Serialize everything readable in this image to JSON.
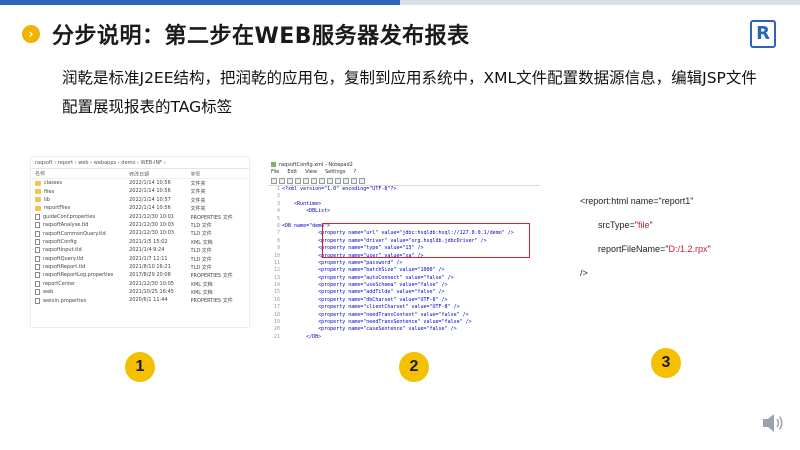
{
  "slide": {
    "title": "分步说明：第二步在WEB服务器发布报表",
    "bullet_glyph": "›",
    "logo_letter": "R",
    "description": "润乾是标准J2EE结构，把润乾的应用包，复制到应用系统中，XML文件配置数据源信息，编辑JSP文件配置展现报表的TAG标签"
  },
  "explorer": {
    "path": "raqsoft  ›  report  ›  web  ›  webapps  ›  demo  ›  WEB-INF  ›",
    "headers": [
      "名称",
      "修改日期",
      "类型"
    ],
    "rows": [
      {
        "name": "classes",
        "date": "2022/1/14 10:56",
        "type": "文件夹",
        "icon": "folder"
      },
      {
        "name": "files",
        "date": "2022/1/14 10:56",
        "type": "文件夹",
        "icon": "folder"
      },
      {
        "name": "lib",
        "date": "2022/1/14 10:57",
        "type": "文件夹",
        "icon": "folder"
      },
      {
        "name": "reportFiles",
        "date": "2022/1/14 10:56",
        "type": "文件夹",
        "icon": "folder"
      },
      {
        "name": "guideConf.properties",
        "date": "2021/12/30 10:01",
        "type": "PROPERTIES 文件",
        "icon": "file"
      },
      {
        "name": "raqsoftAnalyse.tld",
        "date": "2021/12/30 10:03",
        "type": "TLD 文件",
        "icon": "file"
      },
      {
        "name": "raqsoftCommonQuery.tld",
        "date": "2021/12/30 10:03",
        "type": "TLD 文件",
        "icon": "file"
      },
      {
        "name": "raqsoftConfig",
        "date": "2021/1/5 15:02",
        "type": "XML 文档",
        "icon": "file"
      },
      {
        "name": "raqsoftInput.tld",
        "date": "2021/1/4 9:24",
        "type": "TLD 文件",
        "icon": "file"
      },
      {
        "name": "raqsoftQuery.tld",
        "date": "2021/1/7 11:11",
        "type": "TLD 文件",
        "icon": "file"
      },
      {
        "name": "raqsoftReport.tld",
        "date": "2021/8/10 16:21",
        "type": "TLD 文件",
        "icon": "file"
      },
      {
        "name": "raqsoftReportLog.properties",
        "date": "2017/8/29 20:08",
        "type": "PROPERTIES 文件",
        "icon": "file"
      },
      {
        "name": "reportCenter",
        "date": "2021/12/30 10:05",
        "type": "XML 文档",
        "icon": "file"
      },
      {
        "name": "web",
        "date": "2021/10/25 16:45",
        "type": "XML 文档",
        "icon": "file"
      },
      {
        "name": "weixin.properties",
        "date": "2020/6/1 11:44",
        "type": "PROPERTIES 文件",
        "icon": "file"
      }
    ]
  },
  "notepad": {
    "title": "raqsoftConfig.xml - Notepad2",
    "menu": [
      "File",
      "Edit",
      "View",
      "Settings",
      "?"
    ],
    "lines": [
      {
        "n": "1",
        "text": "<?xml version=\"1.0\" encoding=\"UTF-8\"?>"
      },
      {
        "n": "2",
        "text": ""
      },
      {
        "n": "3",
        "text": "    <Runtime>"
      },
      {
        "n": "4",
        "text": "        <DBList>"
      },
      {
        "n": "5",
        "text": ""
      },
      {
        "n": "6",
        "text": "<DB name=\"demo\">"
      },
      {
        "n": "7",
        "text": "            <property name=\"url\" value=\"jdbc:hsqldb:hsql://127.0.0.1/demo\" />"
      },
      {
        "n": "8",
        "text": "            <property name=\"driver\" value=\"org.hsqldb.jdbcDriver\" />"
      },
      {
        "n": "9",
        "text": "            <property name=\"type\" value=\"13\" />"
      },
      {
        "n": "10",
        "text": "            <property name=\"user\" value=\"sa\" />"
      },
      {
        "n": "11",
        "text": "            <property name=\"password\" />"
      },
      {
        "n": "12",
        "text": "            <property name=\"batchSize\" value=\"1000\" />"
      },
      {
        "n": "13",
        "text": "            <property name=\"autoConnect\" value=\"false\" />"
      },
      {
        "n": "14",
        "text": "            <property name=\"useSchema\" value=\"false\" />"
      },
      {
        "n": "15",
        "text": "            <property name=\"addTilde\" value=\"false\" />"
      },
      {
        "n": "16",
        "text": "            <property name=\"dbCharset\" value=\"UTF-8\" />"
      },
      {
        "n": "17",
        "text": "            <property name=\"clientCharset\" value=\"UTF-8\" />"
      },
      {
        "n": "18",
        "text": "            <property name=\"needTransContent\" value=\"false\" />"
      },
      {
        "n": "19",
        "text": "            <property name=\"needTransSentence\" value=\"false\" />"
      },
      {
        "n": "20",
        "text": "            <property name=\"caseSentence\" value=\"false\" />"
      },
      {
        "n": "21",
        "text": "        </DB>"
      }
    ]
  },
  "snippet": {
    "line1": "<report:html name=\"report1\"",
    "line2_prefix": "srcType=\"",
    "line2_value": "file",
    "line2_suffix": "\"",
    "line3_prefix": "reportFileName=\"",
    "line3_value": "D:/1.2.rpx",
    "line3_suffix": "\"",
    "line4": "/>"
  },
  "badges": [
    "1",
    "2",
    "3"
  ],
  "colors": {
    "accent": "#2e63b8",
    "badge": "#f5c000",
    "highlight": "#e02020"
  }
}
